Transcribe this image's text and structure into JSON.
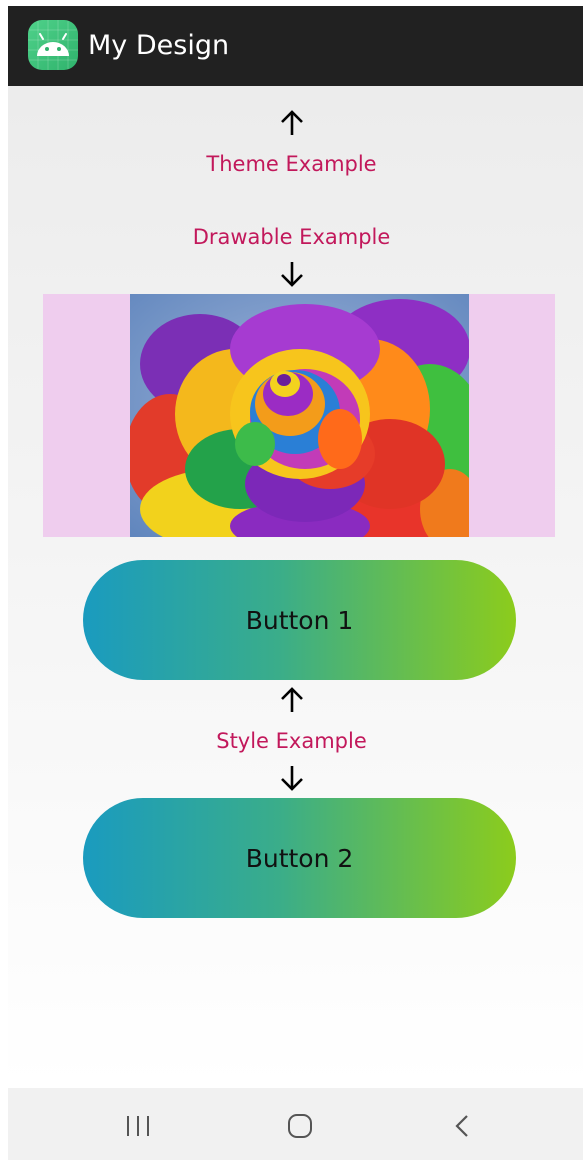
{
  "app": {
    "title": "My Design",
    "icon": "android-icon",
    "bar_color": "#212121",
    "icon_color": "#3ddc84"
  },
  "content": {
    "theme_label": "Theme Example",
    "drawable_label": "Drawable Example",
    "style_label": "Style Example",
    "label_color": "#c2185b",
    "drawable_background": "#efcdee",
    "drawable_image": "rainbow-rose-image",
    "button1_label": "Button 1",
    "button2_label": "Button 2",
    "button_gradient": [
      "#1a9bbf",
      "#8ccc1c"
    ]
  },
  "nav": {
    "recents": "recents-icon",
    "home": "home-icon",
    "back": "back-icon"
  }
}
